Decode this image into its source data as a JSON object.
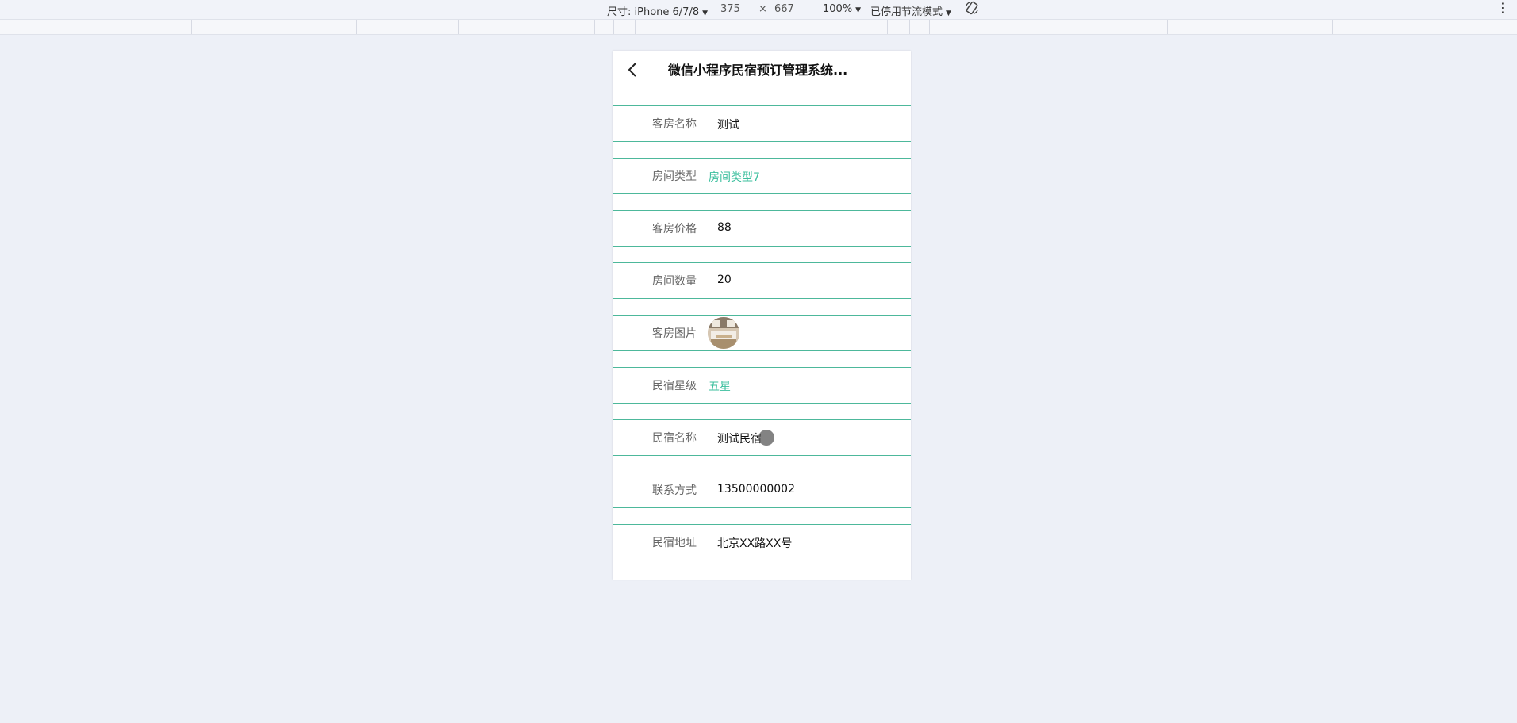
{
  "toolbar": {
    "device": "尺寸: iPhone 6/7/8",
    "width": "375",
    "times": "×",
    "height": "667",
    "zoom": "100%",
    "throttle": "已停用节流模式"
  },
  "page": {
    "title": "微信小程序民宿预订管理系统..."
  },
  "fields": [
    {
      "label": "客房名称",
      "value": "测试",
      "type": "text"
    },
    {
      "label": "房间类型",
      "value": "房间类型7",
      "type": "accent"
    },
    {
      "label": "客房价格",
      "value": "88",
      "type": "text"
    },
    {
      "label": "房间数量",
      "value": "20",
      "type": "text"
    },
    {
      "label": "客房图片",
      "value": "",
      "type": "image"
    },
    {
      "label": "民宿星级",
      "value": "五星",
      "type": "accent"
    },
    {
      "label": "民宿名称",
      "value": "测试民宿",
      "type": "text"
    },
    {
      "label": "联系方式",
      "value": "13500000002",
      "type": "text"
    },
    {
      "label": "民宿地址",
      "value": "北京XX路XX号",
      "type": "text"
    }
  ],
  "colors": {
    "accent": "#3cbf9e",
    "divider": "#4db89b",
    "background": "#edf0f7"
  }
}
